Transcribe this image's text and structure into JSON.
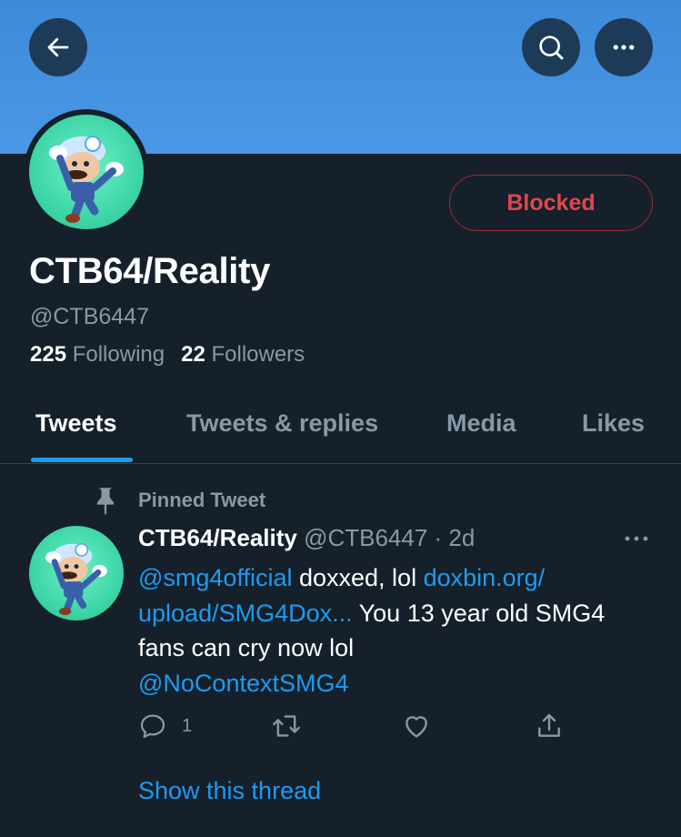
{
  "header": {
    "back_icon": "arrow-left-icon",
    "search_icon": "search-icon",
    "more_icon": "more-horizontal-icon",
    "banner_color": "#4a98e6"
  },
  "profile": {
    "display_name": "CTB64/Reality",
    "handle": "@CTB6447",
    "following_count": "225",
    "following_label": "Following",
    "followers_count": "22",
    "followers_label": "Followers",
    "blocked_label": "Blocked",
    "blocked_color": "#e0474d"
  },
  "tabs": [
    {
      "label": "Tweets",
      "active": true
    },
    {
      "label": "Tweets & replies",
      "active": false
    },
    {
      "label": "Media",
      "active": false
    },
    {
      "label": "Likes",
      "active": false
    }
  ],
  "tweet": {
    "pinned_label": "Pinned Tweet",
    "author_name": "CTB64/Reality",
    "author_handle": "@CTB6447",
    "separator": " · ",
    "time": "2d",
    "mention_1": "@smg4official",
    "text_1": " doxxed, lol ",
    "link_1": "doxbin.org/",
    "link_2": "upload/SMG4Dox...",
    "text_2": " You 13 year old SMG4 fans can cry now lol",
    "mention_2": "@NoContextSMG4",
    "reply_count": "1",
    "show_thread_label": "Show this thread",
    "link_color": "#1d9bf0"
  }
}
